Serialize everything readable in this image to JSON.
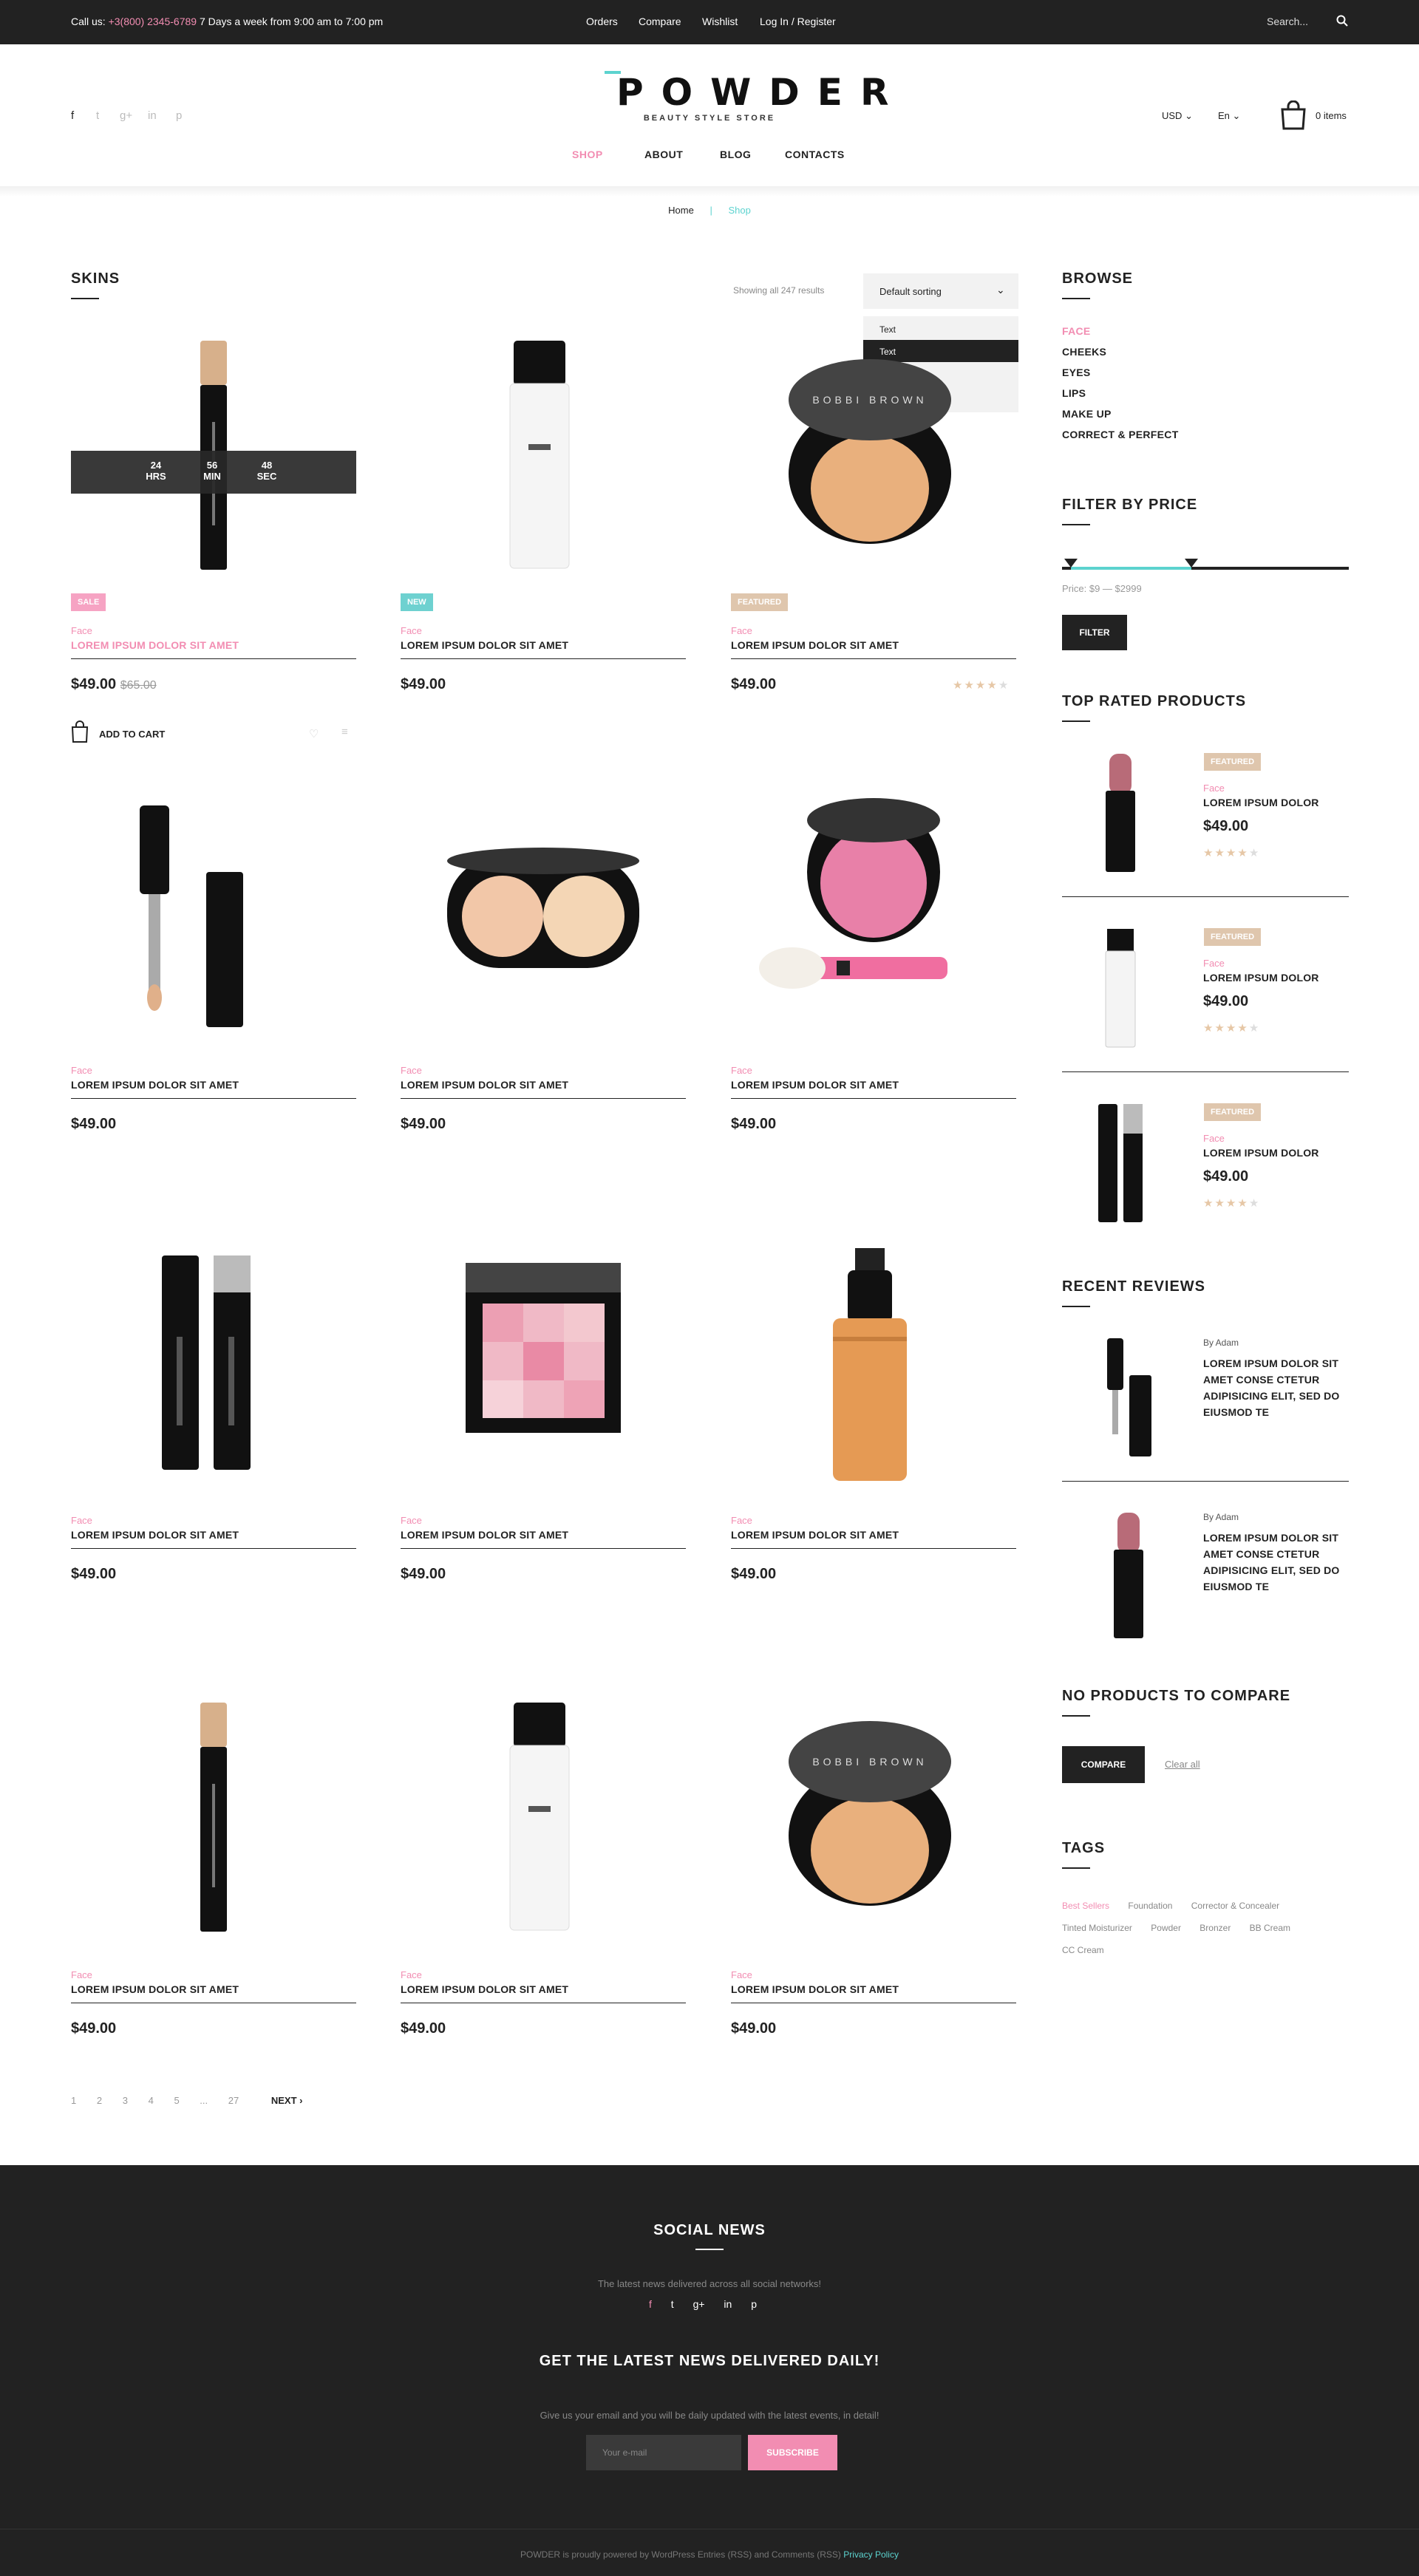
{
  "topbar": {
    "call_label": "Call us:",
    "phone": "+3(800) 2345-6789",
    "hours": "7 Days a week from 9:00 am to 7:00 pm",
    "links": [
      "Orders",
      "Compare",
      "Wishlist",
      "Log In / Register"
    ],
    "search_placeholder": "Search..."
  },
  "header": {
    "logo": "POWDER",
    "logo_subtitle": "BEAUTY STYLE STORE",
    "currency": "USD",
    "language": "En",
    "cart_count": "0 items",
    "nav": [
      "SHOP",
      "ABOUT",
      "BLOG",
      "CONTACTS"
    ]
  },
  "breadcrumb": {
    "home": "Home",
    "separator": "|",
    "current": "Shop"
  },
  "main": {
    "title": "SKINS",
    "results": "Showing all 247 results",
    "sort": {
      "selected": "Default sorting",
      "options": [
        "Text",
        "Text",
        "Text",
        "Text"
      ],
      "highlighted_index": 1
    },
    "countdown": {
      "hrs": "24",
      "hrs_label": "HRS",
      "min": "56",
      "min_label": "MIN",
      "sec": "48",
      "sec_label": "SEC"
    },
    "add_to_cart": "ADD TO CART",
    "products": [
      {
        "cat": "Face",
        "name": "LOREM IPSUM DOLOR SIT AMET",
        "price": "$49.00",
        "old_price": "$65.00",
        "badge": "SALE",
        "name_pink": true
      },
      {
        "cat": "Face",
        "name": "LOREM IPSUM DOLOR SIT AMET",
        "price": "$49.00",
        "old_price": "",
        "badge": "NEW"
      },
      {
        "cat": "Face",
        "name": "LOREM IPSUM DOLOR SIT AMET",
        "price": "$49.00",
        "old_price": "",
        "badge": "FEATURED",
        "rating": 4
      },
      {
        "cat": "Face",
        "name": "LOREM IPSUM DOLOR SIT AMET",
        "price": "$49.00"
      },
      {
        "cat": "Face",
        "name": "LOREM IPSUM DOLOR SIT AMET",
        "price": "$49.00"
      },
      {
        "cat": "Face",
        "name": "LOREM IPSUM DOLOR SIT AMET",
        "price": "$49.00"
      },
      {
        "cat": "Face",
        "name": "LOREM IPSUM DOLOR SIT AMET",
        "price": "$49.00"
      },
      {
        "cat": "Face",
        "name": "LOREM IPSUM DOLOR SIT AMET",
        "price": "$49.00"
      },
      {
        "cat": "Face",
        "name": "LOREM IPSUM DOLOR SIT AMET",
        "price": "$49.00"
      },
      {
        "cat": "Face",
        "name": "LOREM IPSUM DOLOR SIT AMET",
        "price": "$49.00"
      },
      {
        "cat": "Face",
        "name": "LOREM IPSUM DOLOR SIT AMET",
        "price": "$49.00"
      },
      {
        "cat": "Face",
        "name": "LOREM IPSUM DOLOR SIT AMET",
        "price": "$49.00"
      }
    ],
    "pagination": [
      "1",
      "2",
      "3",
      "4",
      "5",
      "...",
      "27"
    ],
    "next": "NEXT"
  },
  "sidebar": {
    "browse_title": "BROWSE",
    "browse": [
      "FACE",
      "CHEEKS",
      "EYES",
      "LIPS",
      "MAKE UP",
      "CORRECT & PERFECT"
    ],
    "price_title": "FILTER BY PRICE",
    "price_range": "Price: $9 — $2999",
    "price_low_fraction": 0.03,
    "price_high_fraction": 0.45,
    "filter_button": "FILTER",
    "top_rated_title": "TOP RATED PRODUCTS",
    "top_rated": [
      {
        "badge": "FEATURED",
        "cat": "Face",
        "name": "LOREM IPSUM DOLOR",
        "price": "$49.00",
        "rating": 4
      },
      {
        "badge": "FEATURED",
        "cat": "Face",
        "name": "LOREM IPSUM DOLOR",
        "price": "$49.00",
        "rating": 4
      },
      {
        "badge": "FEATURED",
        "cat": "Face",
        "name": "LOREM IPSUM DOLOR",
        "price": "$49.00",
        "rating": 4
      }
    ],
    "reviews_title": "RECENT REVIEWS",
    "reviews": [
      {
        "by": "By Adam",
        "text": "LOREM IPSUM DOLOR SIT AMET CONSE CTETUR ADIPISICING ELIT, SED DO EIUSMOD TE"
      },
      {
        "by": "By Adam",
        "text": "LOREM IPSUM DOLOR SIT AMET CONSE CTETUR ADIPISICING ELIT, SED DO EIUSMOD TE"
      }
    ],
    "compare_title": "NO PRODUCTS TO COMPARE",
    "compare_button": "COMPARE",
    "clear_all": "Clear all",
    "tags_title": "TAGS",
    "tags": [
      "Best Sellers",
      "Foundation",
      "Corrector & Concealer",
      "Tinted Moisturizer",
      "Powder",
      "Bronzer",
      "BB Cream",
      "CC Cream"
    ]
  },
  "footer": {
    "social_title": "SOCIAL NEWS",
    "social_text": "The latest news delivered across all social networks!",
    "news_title": "GET THE LATEST NEWS DELIVERED DAILY!",
    "news_text": "Give us your email and you will be daily updated with the latest events, in detail!",
    "email_placeholder": "Your e-mail",
    "subscribe": "SUBSCRIBE",
    "copyright": "POWDER is proudly powered by WordPress Entries (RSS) and Comments (RSS)",
    "privacy": "Privacy Policy"
  },
  "colors": {
    "accent_pink": "#f28db2",
    "accent_teal": "#5cd3cf",
    "dark": "#222222",
    "featured_badge": "#dfc6ad"
  }
}
